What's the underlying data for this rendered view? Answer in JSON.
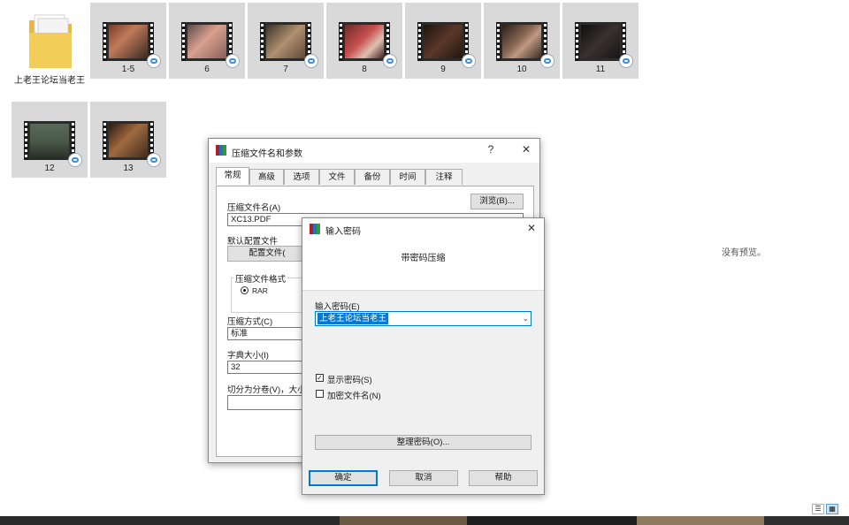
{
  "explorer": {
    "folder": {
      "name": "上老王论坛当老王",
      "icon": "folder-icon"
    },
    "videos": [
      {
        "name": "1-5"
      },
      {
        "name": "6"
      },
      {
        "name": "7"
      },
      {
        "name": "8"
      },
      {
        "name": "9"
      },
      {
        "name": "10"
      },
      {
        "name": "11"
      },
      {
        "name": "12"
      },
      {
        "name": "13"
      }
    ],
    "preview_text": "没有预览。",
    "view_buttons": [
      "details-view-icon",
      "large-icons-view-icon"
    ]
  },
  "archive_dialog": {
    "title": "压缩文件名和参数",
    "help_btn": "?",
    "close_btn": "✕",
    "tabs": [
      {
        "label": "常规",
        "active": true
      },
      {
        "label": "高级"
      },
      {
        "label": "选项"
      },
      {
        "label": "文件"
      },
      {
        "label": "备份"
      },
      {
        "label": "时间"
      },
      {
        "label": "注释"
      }
    ],
    "archive_name_label": "压缩文件名(A)",
    "archive_name_value": "XC13.PDF",
    "browse_btn": "浏览(B)...",
    "profile_label": "默认配置文件",
    "profile_btn": "配置文件(",
    "format_group": "压缩文件格式",
    "format_rar": "RAR",
    "method_label": "压缩方式(C)",
    "method_value": "标准",
    "dict_label": "字典大小(I)",
    "dict_value": "32",
    "split_label": "切分为分卷(V)，大小"
  },
  "password_dialog": {
    "title": "输入密码",
    "close_btn": "✕",
    "heading": "带密码压缩",
    "password_label": "输入密码(E)",
    "password_value": "上老王论坛当老王",
    "show_password": "显示密码(S)",
    "show_password_checked": true,
    "encrypt_names": "加密文件名(N)",
    "encrypt_names_checked": false,
    "organize_btn": "整理密码(O)...",
    "ok_btn": "确定",
    "cancel_btn": "取消",
    "help_btn": "帮助"
  },
  "colors": {
    "tile_bg": "#d9d9d9",
    "selection": "#0078d7",
    "dialog_bg": "#f0f0f0"
  }
}
